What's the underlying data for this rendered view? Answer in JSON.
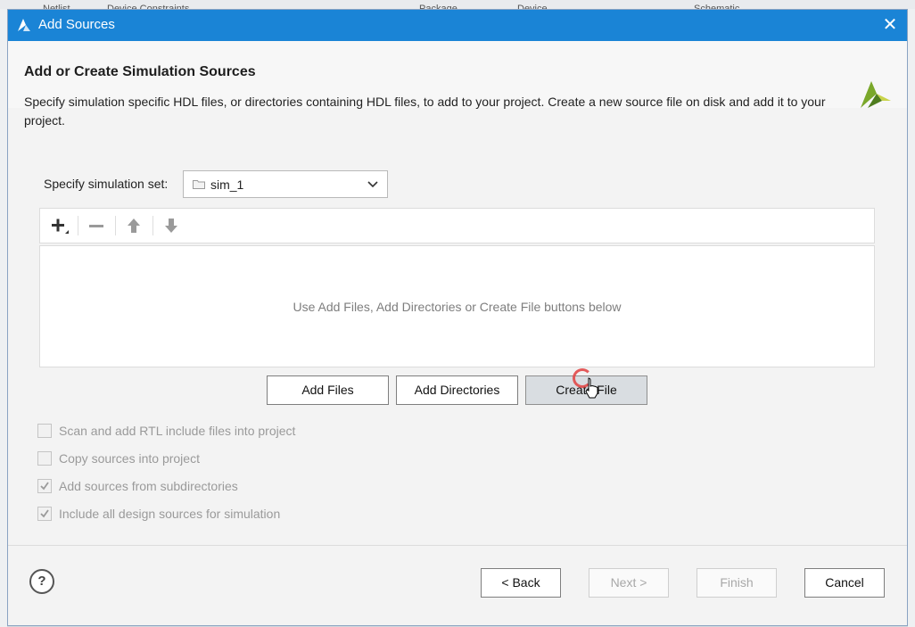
{
  "background": {
    "tabs": [
      "Netlist",
      "Device Constraints",
      "Package",
      "Device",
      "Schematic"
    ]
  },
  "dialog": {
    "title": "Add Sources",
    "heading": "Add or Create Simulation Sources",
    "description": "Specify simulation specific HDL files, or directories containing HDL files, to add to your project. Create a new source file on disk and add it to your project.",
    "simulation_set": {
      "label": "Specify simulation set:",
      "value": "sim_1"
    },
    "toolbar": {
      "add": "add-icon",
      "remove": "remove-icon",
      "move_up": "arrow-up-icon",
      "move_down": "arrow-down-icon"
    },
    "file_list": {
      "empty_message": "Use Add Files, Add Directories or Create File buttons below"
    },
    "action_buttons": {
      "add_files": "Add Files",
      "add_directories": "Add Directories",
      "create_file": "Create File"
    },
    "options": [
      {
        "label": "Scan and add RTL include files into project",
        "checked": false
      },
      {
        "label": "Copy sources into project",
        "checked": false
      },
      {
        "label": "Add sources from subdirectories",
        "checked": true
      },
      {
        "label": "Include all design sources for simulation",
        "checked": true
      }
    ],
    "footer": {
      "help": "?",
      "back": "< Back",
      "next": "Next >",
      "finish": "Finish",
      "cancel": "Cancel"
    }
  },
  "colors": {
    "titlebar": "#1a84d6",
    "accent_logo_green": "#7aa82a",
    "accent_logo_yellow": "#c9d44a"
  }
}
